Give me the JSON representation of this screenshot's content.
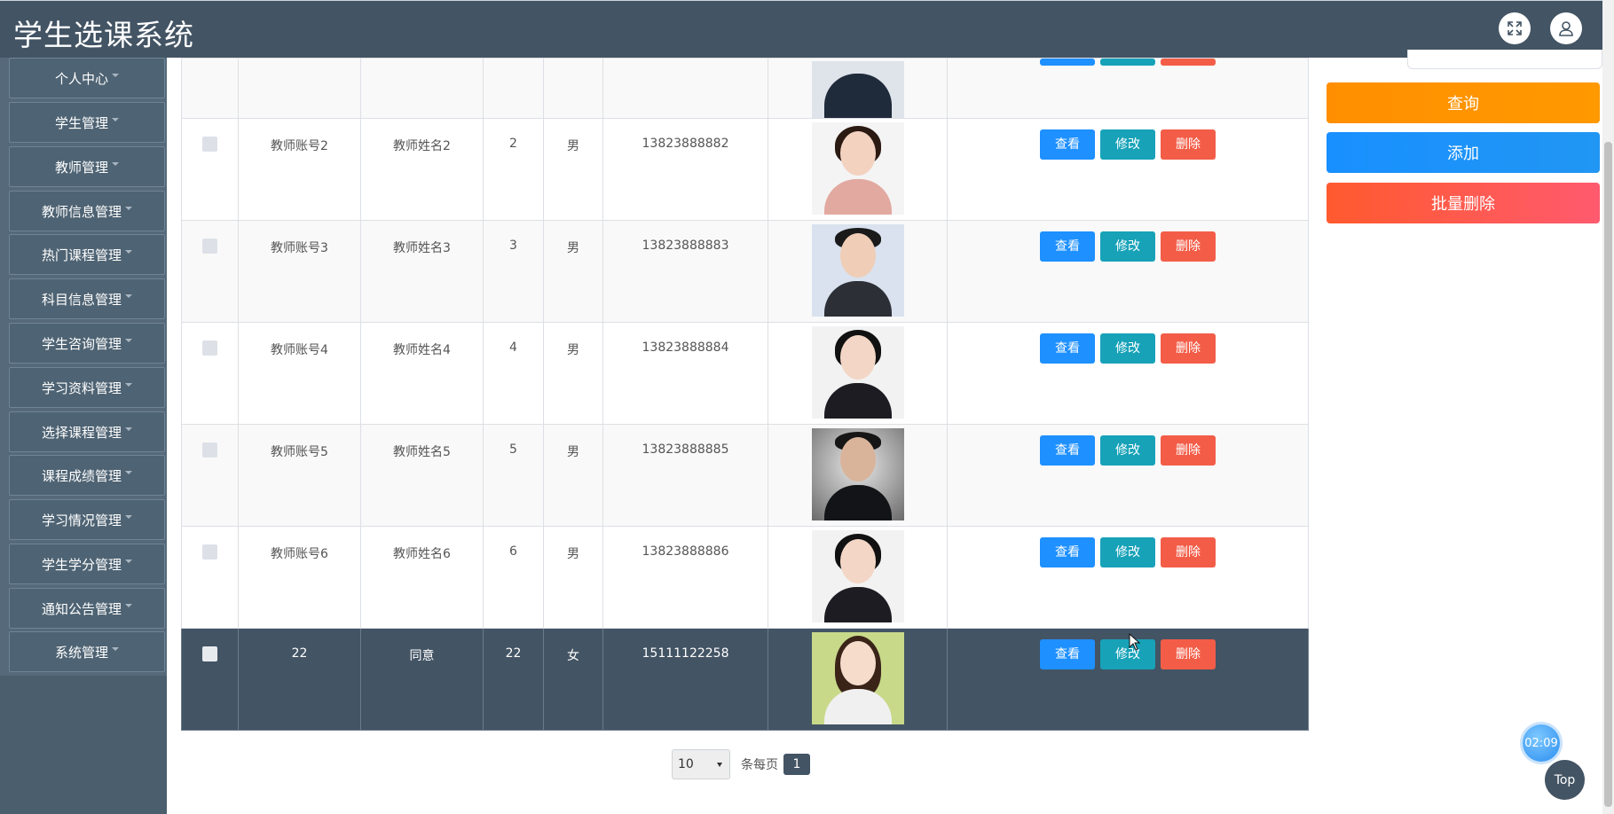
{
  "app": {
    "title": "学生选课系统"
  },
  "header": {
    "fullscreen_icon": "fullscreen-icon",
    "user_icon": "user-icon"
  },
  "sidebar": {
    "items": [
      {
        "label": "个人中心"
      },
      {
        "label": "学生管理"
      },
      {
        "label": "教师管理"
      },
      {
        "label": "教师信息管理"
      },
      {
        "label": "热门课程管理"
      },
      {
        "label": "科目信息管理"
      },
      {
        "label": "学生咨询管理"
      },
      {
        "label": "学习资料管理"
      },
      {
        "label": "选择课程管理"
      },
      {
        "label": "课程成绩管理"
      },
      {
        "label": "学习情况管理"
      },
      {
        "label": "学生学分管理"
      },
      {
        "label": "通知公告管理"
      },
      {
        "label": "系统管理"
      }
    ]
  },
  "actions": {
    "view": "查看",
    "edit": "修改",
    "delete": "删除"
  },
  "table": {
    "rows": [
      {
        "account": "教师账号2",
        "name": "教师姓名2",
        "num": "2",
        "gender": "男",
        "phone": "13823888882"
      },
      {
        "account": "教师账号3",
        "name": "教师姓名3",
        "num": "3",
        "gender": "男",
        "phone": "13823888883"
      },
      {
        "account": "教师账号4",
        "name": "教师姓名4",
        "num": "4",
        "gender": "男",
        "phone": "13823888884"
      },
      {
        "account": "教师账号5",
        "name": "教师姓名5",
        "num": "5",
        "gender": "男",
        "phone": "13823888885"
      },
      {
        "account": "教师账号6",
        "name": "教师姓名6",
        "num": "6",
        "gender": "男",
        "phone": "13823888886"
      },
      {
        "account": "22",
        "name": "同意",
        "num": "22",
        "gender": "女",
        "phone": "15111122258"
      }
    ]
  },
  "panel": {
    "query": "查询",
    "add": "添加",
    "batch_delete": "批量删除"
  },
  "pagination": {
    "page_size": "10",
    "per_page_label": "条每页",
    "current_page": "1"
  },
  "floating": {
    "timer": "02:09",
    "top": "Top"
  },
  "colors": {
    "primary_dark": "#435464",
    "query": "#ff9100",
    "add": "#1890ff",
    "delete": "#f35d48",
    "edit": "#17a2b8"
  }
}
